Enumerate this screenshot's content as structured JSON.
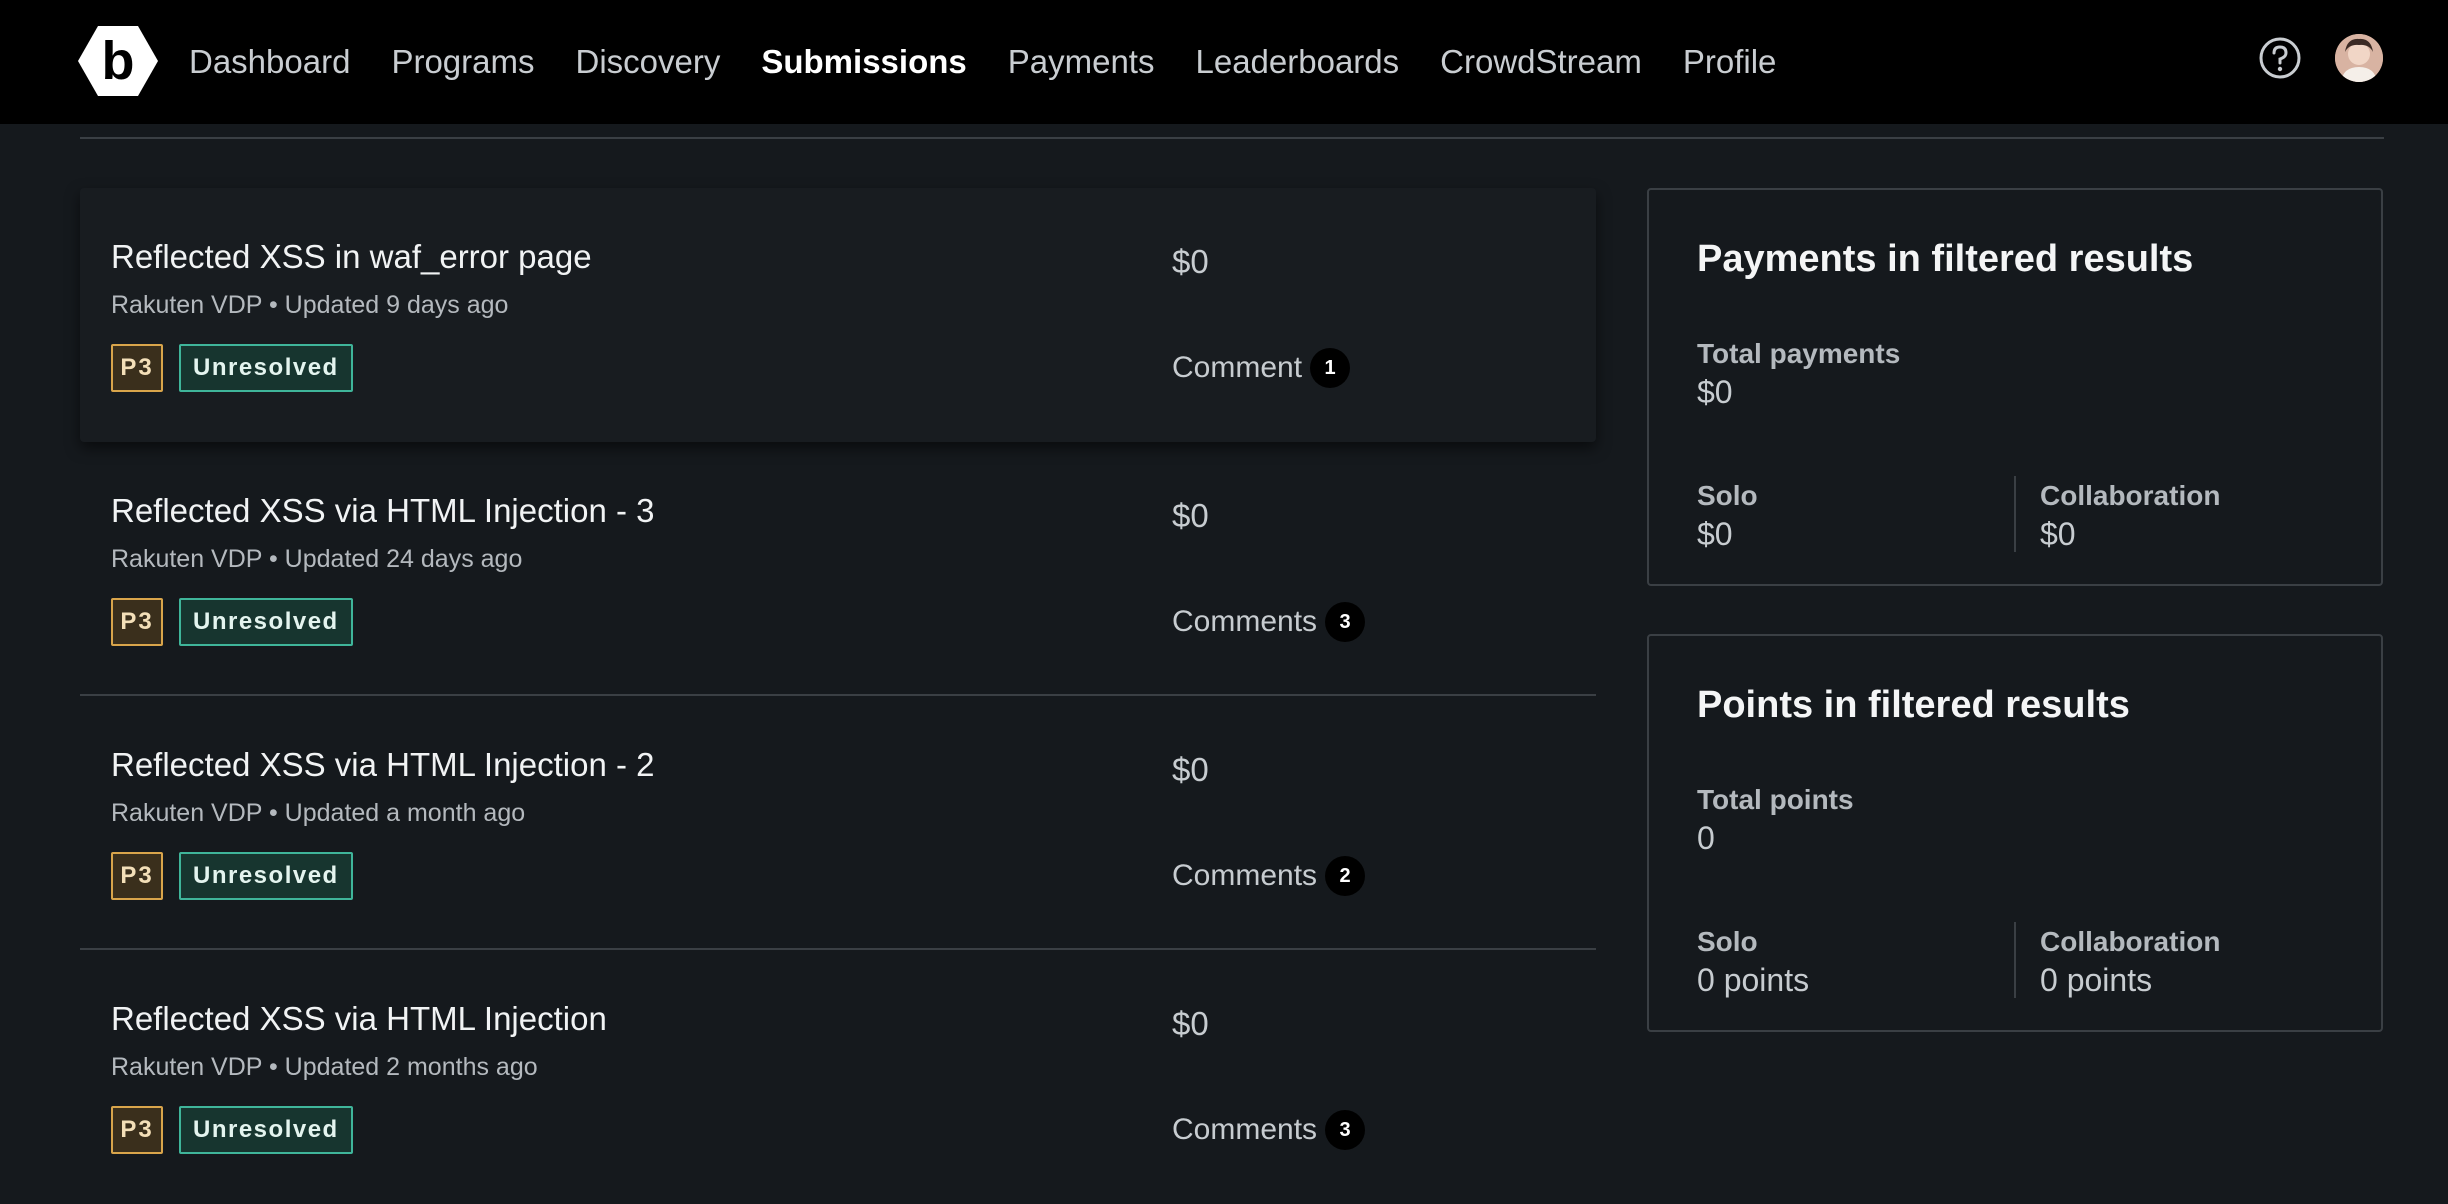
{
  "nav": {
    "items": [
      "Dashboard",
      "Programs",
      "Discovery",
      "Submissions",
      "Payments",
      "Leaderboards",
      "CrowdStream",
      "Profile"
    ],
    "active": "Submissions"
  },
  "submissions": [
    {
      "title": "Reflected XSS in waf_error page",
      "program": "Rakuten VDP",
      "updated": "Updated 9 days ago",
      "priority": "P3",
      "status": "Unresolved",
      "amount": "$0",
      "comments_label": "Comment",
      "comments_count": "1"
    },
    {
      "title": "Reflected XSS via HTML Injection - 3",
      "program": "Rakuten VDP",
      "updated": "Updated 24 days ago",
      "priority": "P3",
      "status": "Unresolved",
      "amount": "$0",
      "comments_label": "Comments",
      "comments_count": "3"
    },
    {
      "title": "Reflected XSS via HTML Injection - 2",
      "program": "Rakuten VDP",
      "updated": "Updated a month ago",
      "priority": "P3",
      "status": "Unresolved",
      "amount": "$0",
      "comments_label": "Comments",
      "comments_count": "2"
    },
    {
      "title": "Reflected XSS via HTML Injection",
      "program": "Rakuten VDP",
      "updated": "Updated 2 months ago",
      "priority": "P3",
      "status": "Unresolved",
      "amount": "$0",
      "comments_label": "Comments",
      "comments_count": "3"
    }
  ],
  "payments_panel": {
    "title": "Payments in filtered results",
    "total_label": "Total payments",
    "total_value": "$0",
    "solo_label": "Solo",
    "solo_value": "$0",
    "collab_label": "Collaboration",
    "collab_value": "$0"
  },
  "points_panel": {
    "title": "Points in filtered results",
    "total_label": "Total points",
    "total_value": "0",
    "solo_label": "Solo",
    "solo_value": "0 points",
    "collab_label": "Collaboration",
    "collab_value": "0 points"
  },
  "colors": {
    "background": "#15191d",
    "topbar": "#000000",
    "priority_border": "#d9a54b",
    "status_border": "#3fb59a"
  },
  "icons": [
    "bugcrowd-logo",
    "help-icon",
    "user-avatar"
  ]
}
